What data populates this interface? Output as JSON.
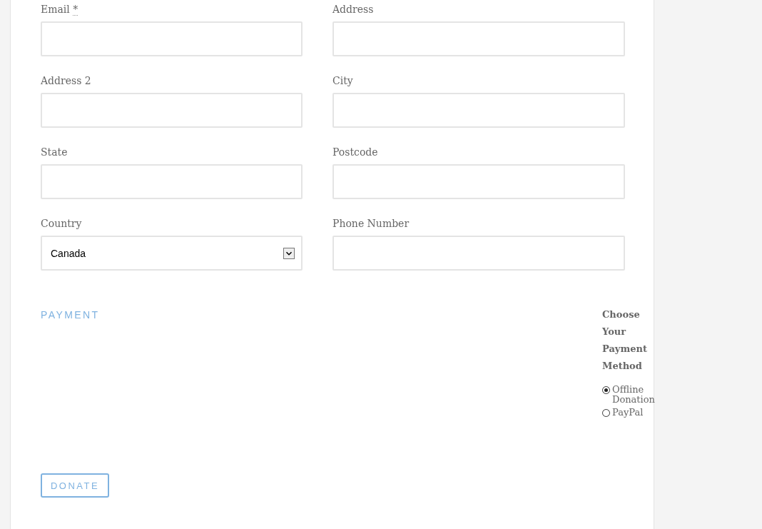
{
  "fields": [
    {
      "label": "Email",
      "required_mark": "*",
      "kind": "text"
    },
    {
      "label": "Address",
      "kind": "text"
    },
    {
      "label": "Address 2",
      "kind": "text"
    },
    {
      "label": "City",
      "kind": "text"
    },
    {
      "label": "State",
      "kind": "text"
    },
    {
      "label": "Postcode",
      "kind": "text"
    },
    {
      "label": "Country",
      "kind": "select",
      "value": "Canada"
    },
    {
      "label": "Phone Number",
      "kind": "text"
    }
  ],
  "payment": {
    "heading": "PAYMENT",
    "legend": "Choose Your Payment Method",
    "options": [
      {
        "label": "Offline Donation",
        "selected": true
      },
      {
        "label": "PayPal",
        "selected": false
      }
    ]
  },
  "donate_button": "DONATE"
}
